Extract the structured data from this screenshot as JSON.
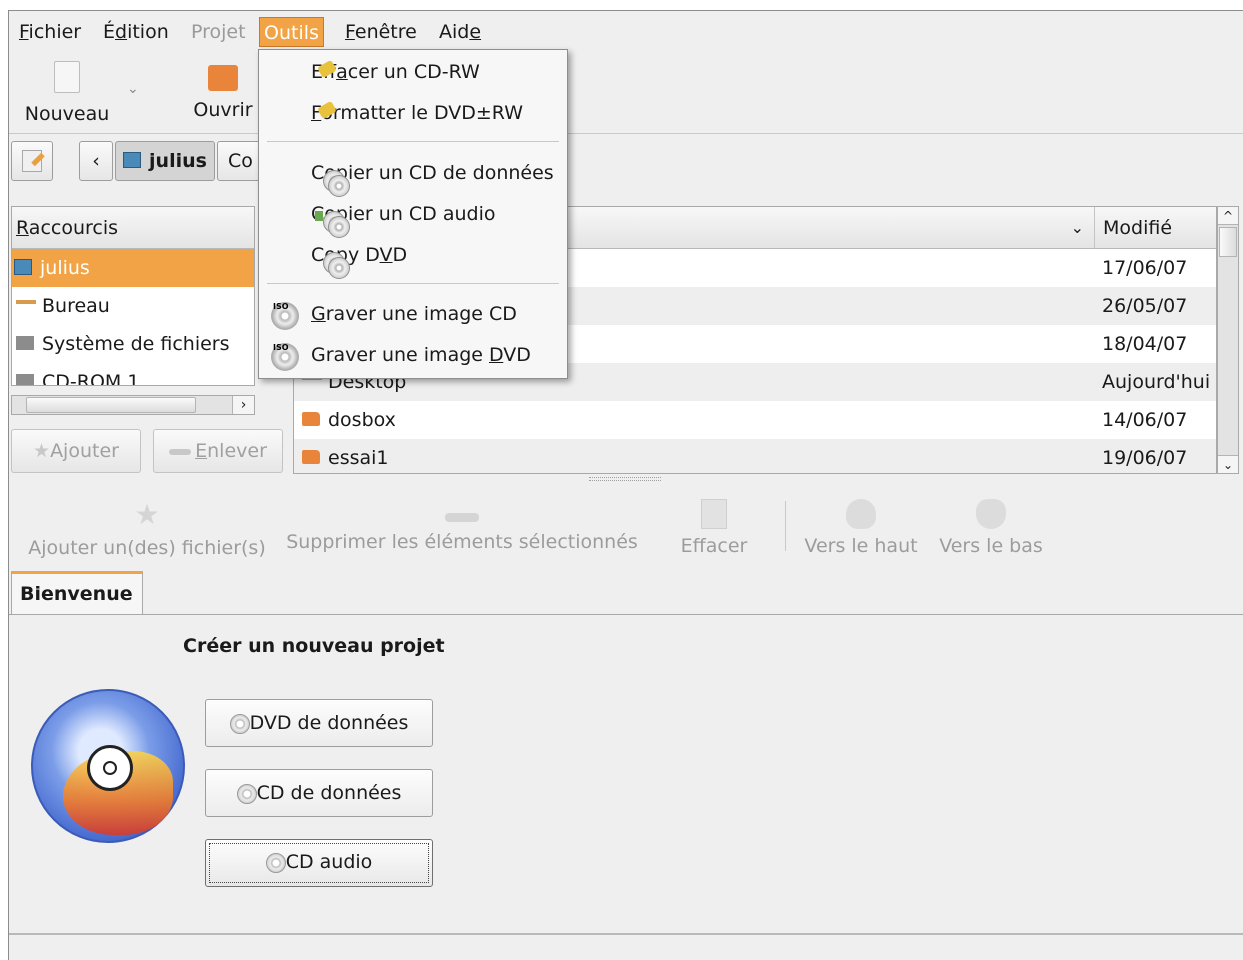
{
  "menubar": {
    "items": [
      {
        "label": "Fichier",
        "ul": "F",
        "rest": "ichier"
      },
      {
        "label": "Édition",
        "pre": "É",
        "ul": "d",
        "rest": "ition"
      },
      {
        "label": "Projet"
      },
      {
        "label": "Outils"
      },
      {
        "label": "Fenêtre",
        "ul": "F",
        "rest": "enêtre"
      },
      {
        "label": "Aide",
        "pre": "Aid",
        "ul": "e"
      }
    ]
  },
  "toolbar": {
    "new_label": "Nouveau",
    "open_label": "Ouvrir"
  },
  "location": {
    "home_label": "julius",
    "next_crumb": "Co"
  },
  "shortcuts": {
    "header": "Raccourcis",
    "items": [
      "julius",
      "Bureau",
      "Système de fichiers",
      "CD-ROM 1"
    ],
    "add_label": "Ajouter",
    "remove_label": "Enlever"
  },
  "files": {
    "col_modified": "Modifié",
    "rows": [
      {
        "name": "",
        "date": "17/06/07"
      },
      {
        "name": "",
        "date": "26/05/07"
      },
      {
        "name": "",
        "date": "18/04/07"
      },
      {
        "name": "Desktop",
        "date": "Aujourd'hui"
      },
      {
        "name": "dosbox",
        "date": "14/06/07"
      },
      {
        "name": "essai1",
        "date": "19/06/07"
      }
    ]
  },
  "project_toolbar": {
    "add_files": "Ajouter un(des) fichier(s)",
    "remove_selected": "Supprimer les éléments sélectionnés",
    "clear": "Effacer",
    "move_up": "Vers le haut",
    "move_down": "Vers le bas"
  },
  "welcome": {
    "tab_label": "Bienvenue",
    "heading": "Créer un nouveau projet",
    "buttons": [
      "DVD de données",
      "CD de données",
      "CD audio"
    ]
  },
  "tools_menu": {
    "items": [
      {
        "label": "Effacer un CD-RW",
        "pre": "Eff",
        "ul": "a",
        "rest": "cer un CD-RW",
        "icon": "broom-icon"
      },
      {
        "label": "Formatter le DVD±RW",
        "pre": "",
        "ul": "F",
        "rest": "ormatter le DVD±RW",
        "icon": "broom-icon"
      },
      {
        "label": "Copier un CD de données",
        "pre": "C",
        "ul": "o",
        "rest": "pier un CD de données",
        "icon": "cd-copy-icon"
      },
      {
        "label": "Copier un CD audio",
        "pre": "Co",
        "ul": "p",
        "rest": "ier un CD audio",
        "icon": "cd-audio-icon"
      },
      {
        "label": "Copy DVD",
        "pre": "Copy D",
        "ul": "V",
        "rest": "D",
        "icon": "cd-copy-icon"
      },
      {
        "label": "Graver une image CD",
        "pre": "",
        "ul": "G",
        "rest": "raver une image CD",
        "icon": "iso-icon"
      },
      {
        "label": "Graver une image DVD",
        "pre": "Graver une image ",
        "ul": "D",
        "rest": "VD",
        "icon": "iso-icon"
      }
    ]
  },
  "colors": {
    "accent": "#f2a345",
    "folder": "#e9853a"
  }
}
